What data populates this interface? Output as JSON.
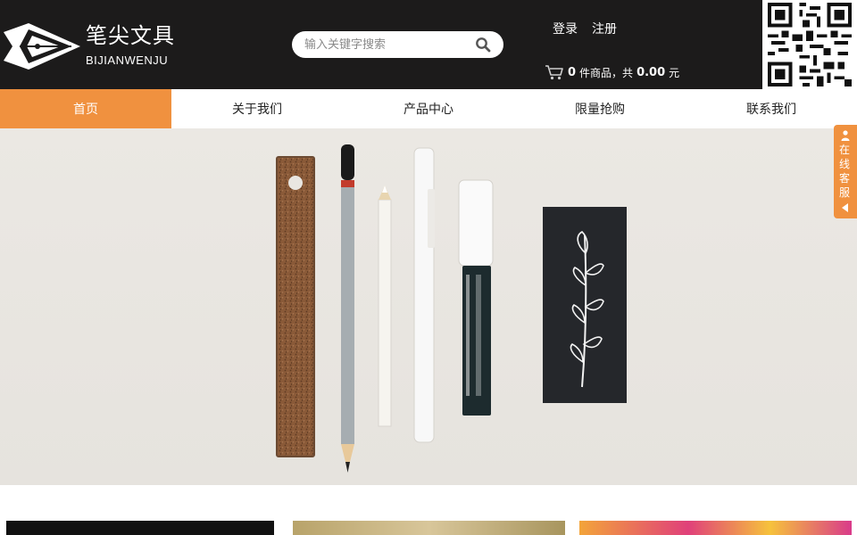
{
  "brand": {
    "name_cn": "笔尖文具",
    "name_en": "BIJIANWENJU"
  },
  "search": {
    "placeholder": "输入关键字搜索",
    "value": ""
  },
  "auth": {
    "login": "登录",
    "register": "注册"
  },
  "cart": {
    "count": "0",
    "items_label": "件商品，共",
    "total": "0.00",
    "currency": "元"
  },
  "nav": {
    "items": [
      {
        "label": "首页",
        "active": true
      },
      {
        "label": "关于我们",
        "active": false
      },
      {
        "label": "产品中心",
        "active": false
      },
      {
        "label": "限量抢购",
        "active": false
      },
      {
        "label": "联系我们",
        "active": false
      }
    ]
  },
  "sidebar": {
    "service_label": "在线客服"
  },
  "colors": {
    "header_bg": "#1c1b1b",
    "accent": "#f0913f",
    "white": "#ffffff"
  },
  "icons": [
    "pen-nib-logo-icon",
    "search-icon",
    "cart-icon",
    "qr-code-icon",
    "user-icon",
    "arrow-left-icon"
  ]
}
